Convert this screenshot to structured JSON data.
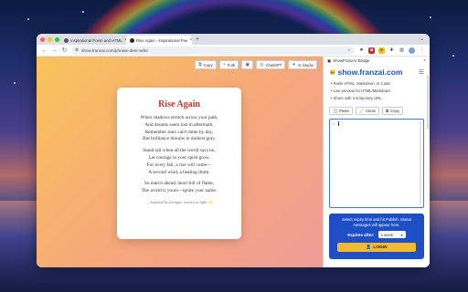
{
  "browser": {
    "tabs": [
      {
        "label": "Inspirational Poem and HTML",
        "active": false,
        "favicon_color": "#555555"
      },
      {
        "label": "Rise Again - Inspirational Poe",
        "active": true,
        "favicon_color": "#2b2b2b"
      }
    ],
    "new_tab_symbol": "+",
    "url": "show.franzai.com/phrase-deer-write"
  },
  "toolbar": {
    "buttons": [
      {
        "label": "Copy",
        "icon": "copy-icon",
        "glyph": "⧉"
      },
      {
        "label": "Fork",
        "icon": "fork-icon",
        "glyph": "⑂"
      },
      {
        "label": "",
        "icon": "screenshot-icon",
        "glyph": "▣"
      },
      {
        "label": "ChatGPT",
        "icon": "chatgpt-icon",
        "glyph": "◎"
      },
      {
        "label": "AI Studio",
        "icon": "ai-studio-icon",
        "glyph": "✦"
      }
    ]
  },
  "poem": {
    "title": "Rise Again",
    "stanzas": [
      [
        "When shadows stretch across your path,",
        "And dreams seem lost in aftermath,",
        "Remember stars can't shine by day,",
        "But brilliance blooms in darkest gray."
      ],
      [
        "Stand tall when all the world says no,",
        "Let courage in your spirit grow.",
        "For every fall, a rise will come—",
        "A second wind, a beating drum."
      ],
      [
        "So march ahead, heart full of flame,",
        "The world is yours—ignite your name."
      ]
    ],
    "footer": "— Inspired by strength, written in light ✨"
  },
  "panel": {
    "header": "ShowFranzAI Bridge",
    "brand": "show.franzai.com",
    "logo_glyph": "🐱",
    "features": [
      "Paste HTML, Markdown, or Code.",
      "Live preview for HTML/Markdown.",
      "Share with a temporary URL."
    ],
    "buttons": [
      {
        "label": "Paste",
        "icon": "paste-icon",
        "glyph": "📋"
      },
      {
        "label": "Clean",
        "icon": "clean-icon",
        "glyph": "🧹"
      },
      {
        "label": "Copy",
        "icon": "copy-icon",
        "glyph": "⧉"
      }
    ],
    "editor_line": "1",
    "info": "Select expiry time and hit Publish. Status messages will appear here.",
    "expires_label": "Expires after:",
    "expires_value": "1 week",
    "login_label": "LOGIN",
    "login_glyph": "👤"
  },
  "colors": {
    "accent": "#1e4fc7",
    "login": "#f5b82e",
    "title": "#c0392b"
  }
}
